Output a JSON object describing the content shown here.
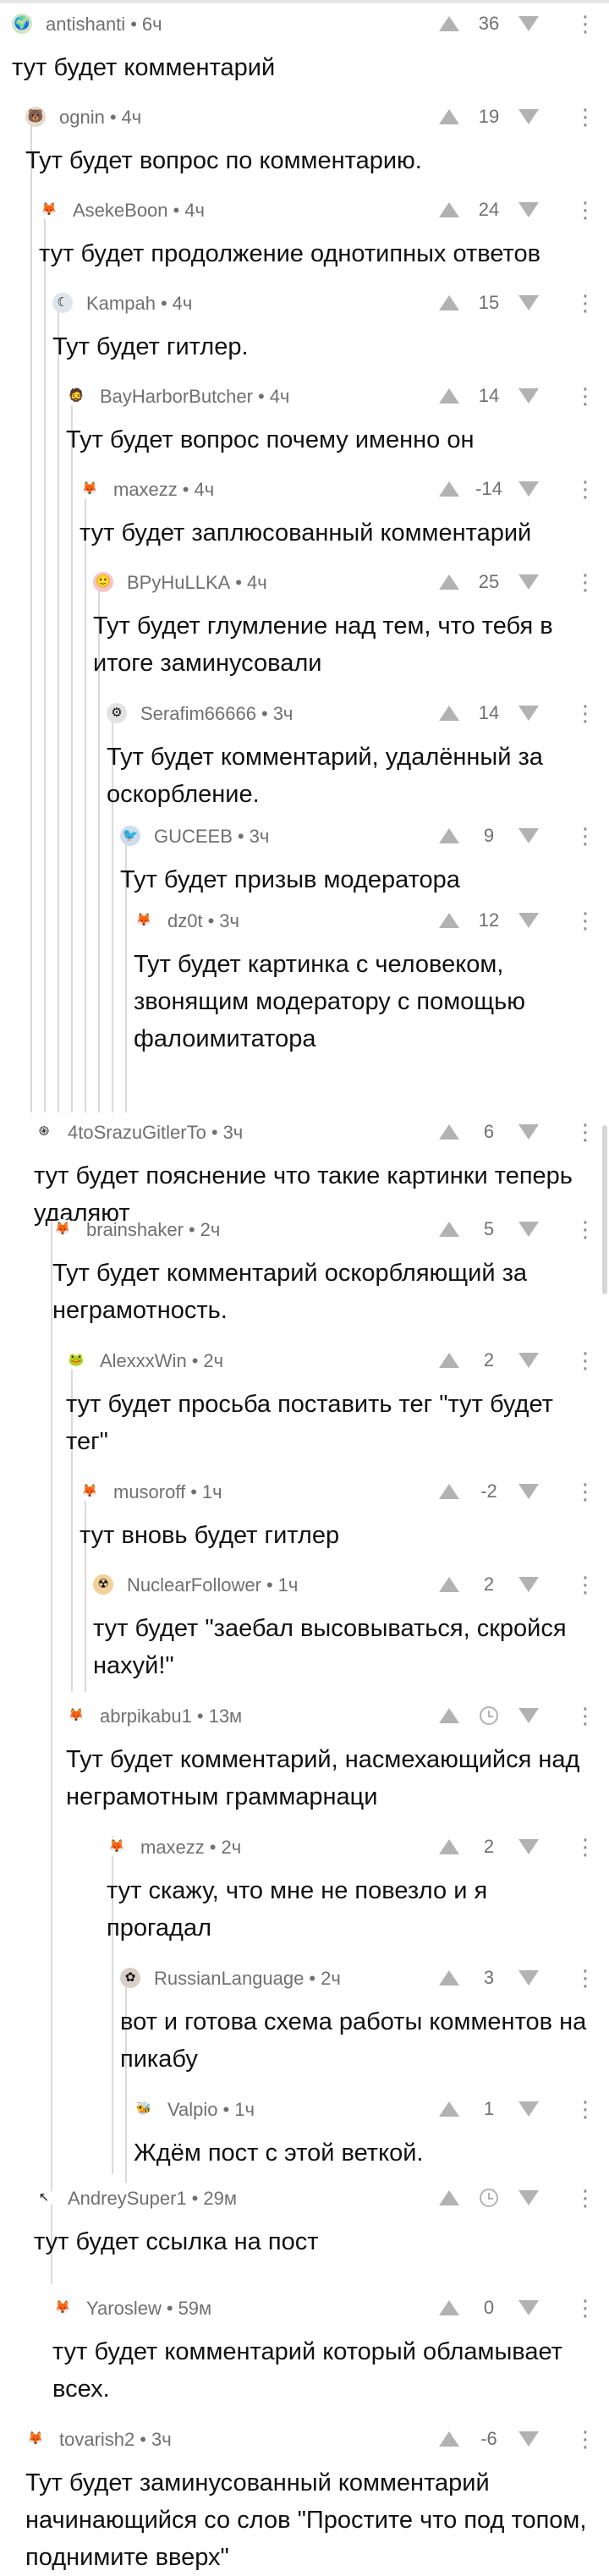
{
  "icons": {
    "vote_up": "arrow-up-icon",
    "vote_down": "arrow-down-icon",
    "menu": "kebab-menu-icon",
    "pending": "clock-icon"
  },
  "colors": {
    "meta_text": "#707070",
    "body_text": "#111111",
    "vote_arrow": "#b2b2b2",
    "thread_line": "#d9d9d9"
  },
  "comments": [
    {
      "author": "antishanti",
      "time": "6ч",
      "score": "36",
      "text": "тут будет комментарий",
      "avatar": "🌍",
      "avatar_bg": "#cfe3c4"
    },
    {
      "author": "ognin",
      "time": "4ч",
      "score": "19",
      "text": "Тут будет вопрос по комментарию.",
      "avatar": "🐻",
      "avatar_bg": "#e3dccb"
    },
    {
      "author": "AsekeBoon",
      "time": "4ч",
      "score": "24",
      "text": "тут будет продолжение однотипных ответов",
      "avatar": "🦊",
      "avatar_bg": "#ffffff"
    },
    {
      "author": "Kampah",
      "time": "4ч",
      "score": "15",
      "text": "Тут будет гитлер.",
      "avatar": "☾",
      "avatar_bg": "#dde6ea"
    },
    {
      "author": "BayHarborButcher",
      "time": "4ч",
      "score": "14",
      "text": "Тут будет вопрос почему именно он",
      "avatar": "🧔",
      "avatar_bg": "#ffffff"
    },
    {
      "author": "maxezz",
      "time": "4ч",
      "score": "-14",
      "text": "тут будет заплюсованный комментарий",
      "avatar": "🦊",
      "avatar_bg": "#ffffff"
    },
    {
      "author": "BPyHuLLKA",
      "time": "4ч",
      "score": "25",
      "text": "Тут будет глумление над тем, что тебя в итоге заминусовали",
      "avatar": "🙂",
      "avatar_bg": "#f3c7c7"
    },
    {
      "author": "Serafim66666",
      "time": "3ч",
      "score": "14",
      "text": "Тут будет комментарий, удалённый за оскорбление.",
      "avatar": "⚙",
      "avatar_bg": "#e2e2e2"
    },
    {
      "author": "GUCEEB",
      "time": "3ч",
      "score": "9",
      "text": "Тут будет призыв модератора",
      "avatar": "🐦",
      "avatar_bg": "#cfdcee"
    },
    {
      "author": "dz0t",
      "time": "3ч",
      "score": "12",
      "text": "Тут будет картинка с человеком, звонящим модератору с помощью фалоимитатора",
      "avatar": "🦊",
      "avatar_bg": "#ffffff"
    },
    {
      "author": "4toSrazuGitlerTo",
      "time": "3ч",
      "score": "6",
      "text": "тут будет пояснение что такие картинки теперь удаляют",
      "avatar": "֍",
      "avatar_bg": "#ffffff"
    },
    {
      "author": "brainshaker",
      "time": "2ч",
      "score": "5",
      "text": "Тут будет комментарий оскорбляющий за неграмотность.",
      "avatar": "🦊",
      "avatar_bg": "#ffffff"
    },
    {
      "author": "AlexxxWin",
      "time": "2ч",
      "score": "2",
      "text": "тут будет просьба поставить тег \"тут будет тег\"",
      "avatar": "🐸",
      "avatar_bg": "#ffffff"
    },
    {
      "author": "musoroff",
      "time": "1ч",
      "score": "-2",
      "text": "тут вновь будет гитлер",
      "avatar": "🦊",
      "avatar_bg": "#ffffff"
    },
    {
      "author": "NuclearFollower",
      "time": "1ч",
      "score": "2",
      "text": "тут будет \"заебал высовываться, скройся нахуй!\"",
      "avatar": "☢",
      "avatar_bg": "#f1d09a"
    },
    {
      "author": "abrpikabu1",
      "time": "13м",
      "score": "",
      "text": "Тут будет комментарий, насмехающийся над неграмотным граммарнаци",
      "avatar": "🦊",
      "avatar_bg": "#ffffff"
    },
    {
      "author": "maxezz",
      "time": "2ч",
      "score": "2",
      "text": "тут скажу, что мне не повезло и я прогадал",
      "avatar": "🦊",
      "avatar_bg": "#ffffff"
    },
    {
      "author": "RussianLanguage",
      "time": "2ч",
      "score": "3",
      "text": "вот и готова схема работы комментов на пикабу",
      "avatar": "✿",
      "avatar_bg": "#d9cfc6"
    },
    {
      "author": "Valpio",
      "time": "1ч",
      "score": "1",
      "text": "Ждём пост с этой веткой.",
      "avatar": "🐝",
      "avatar_bg": "#ffffff"
    },
    {
      "author": "AndreySuper1",
      "time": "29м",
      "score": "",
      "text": "тут будет  ссылка на пост",
      "avatar": "↖",
      "avatar_bg": "#ffffff"
    },
    {
      "author": "Yaroslew",
      "time": "59м",
      "score": "0",
      "text": "тут будет комментарий который обламывает всех.",
      "avatar": "🦊",
      "avatar_bg": "#ffffff"
    },
    {
      "author": "tovarish2",
      "time": "3ч",
      "score": "-6",
      "text": "Тут будет заминусованный комментарий начинающийся со слов \"Простите что под топом, поднимите вверх\"",
      "avatar": "🦊",
      "avatar_bg": "#ffffff"
    }
  ]
}
